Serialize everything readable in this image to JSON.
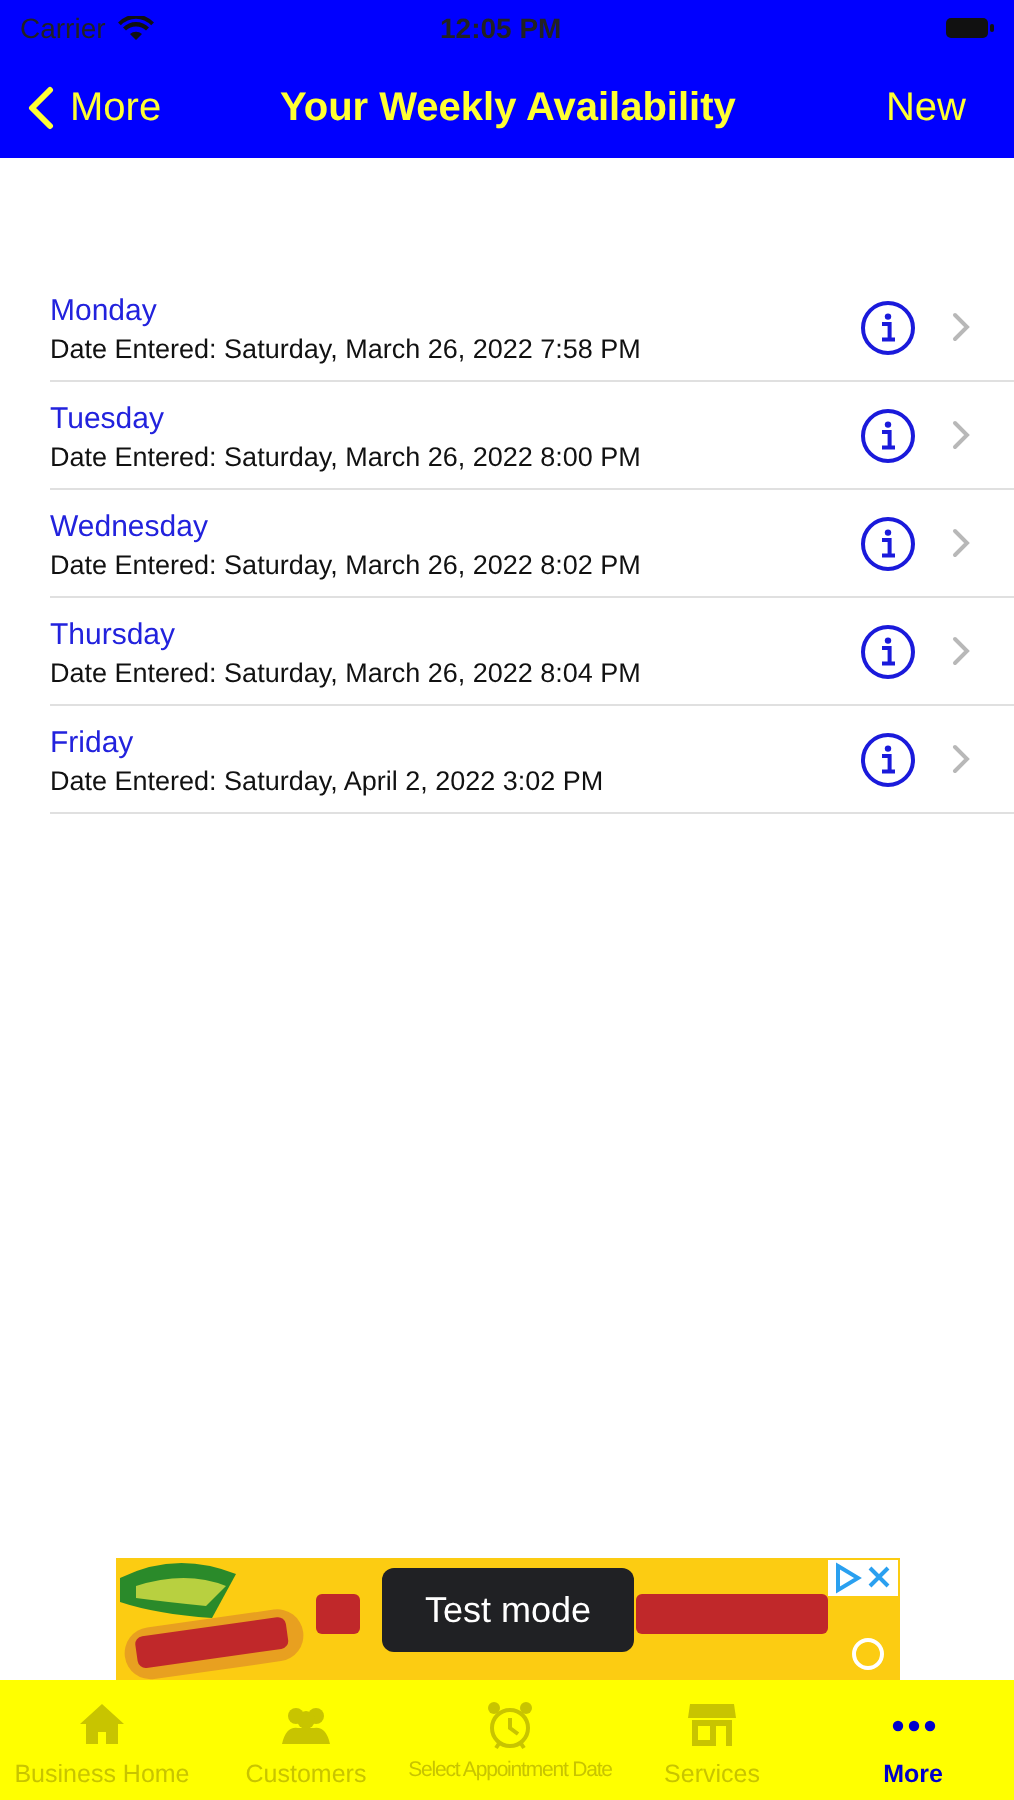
{
  "status_bar": {
    "carrier": "Carrier",
    "time": "12:05 PM"
  },
  "nav_bar": {
    "back": "More",
    "title": "Your Weekly Availability",
    "action": "New"
  },
  "rows": [
    {
      "title": "Monday",
      "subtitle": "Date Entered: Saturday, March 26, 2022 7:58 PM"
    },
    {
      "title": "Tuesday",
      "subtitle": "Date Entered: Saturday, March 26, 2022 8:00 PM"
    },
    {
      "title": "Wednesday",
      "subtitle": "Date Entered: Saturday, March 26, 2022 8:02 PM"
    },
    {
      "title": "Thursday",
      "subtitle": "Date Entered: Saturday, March 26, 2022 8:04 PM"
    },
    {
      "title": "Friday",
      "subtitle": "Date Entered: Saturday, April 2, 2022 3:02 PM"
    }
  ],
  "ad": {
    "kind": "picture",
    "toast": "Test mode"
  },
  "tab_bar": [
    {
      "label": "Business Home",
      "selected": false
    },
    {
      "label": "Customers",
      "selected": false
    },
    {
      "label": "Select Appointment Date",
      "selected": false
    },
    {
      "label": "Services",
      "selected": false
    },
    {
      "label": "More",
      "selected": true
    }
  ]
}
